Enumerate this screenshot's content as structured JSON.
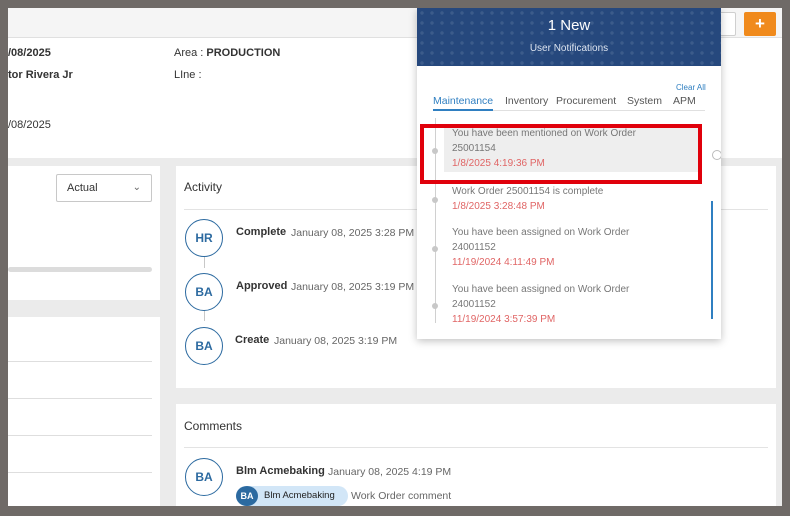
{
  "header": {
    "add_label": "+"
  },
  "info": {
    "date1": "/08/2025",
    "person": "tor Rivera Jr",
    "date2": "/08/2025",
    "area_label": "Area : ",
    "area_value": "PRODUCTION",
    "line_label": "LIne :"
  },
  "left_panel": {
    "select_value": "Actual"
  },
  "activity": {
    "title": "Activity",
    "items": [
      {
        "initials": "HR",
        "action": "Complete",
        "date": "January 08, 2025 3:28 PM"
      },
      {
        "initials": "BA",
        "action": "Approved",
        "date": "January 08, 2025 3:19 PM"
      },
      {
        "initials": "BA",
        "action": "Create",
        "date": "January 08, 2025 3:19 PM"
      }
    ]
  },
  "comments": {
    "title": "Comments",
    "items": [
      {
        "initials": "BA",
        "author": "Blm Acmebaking",
        "date": "January 08, 2025 4:19 PM",
        "mention_initials": "BA",
        "mention_name": "Blm Acmebaking",
        "text": "Work Order comment"
      }
    ]
  },
  "notifications": {
    "title": "1 New",
    "subtitle": "User Notifications",
    "clear_all": "Clear All",
    "tabs": [
      {
        "label": "Maintenance",
        "active": true
      },
      {
        "label": "Inventory",
        "active": false
      },
      {
        "label": "Procurement",
        "active": false
      },
      {
        "label": "System",
        "active": false
      },
      {
        "label": "APM",
        "active": false
      }
    ],
    "items": [
      {
        "line1": "You have been mentioned on Work Order",
        "line2": "25001154",
        "date": "1/8/2025 4:19:36 PM",
        "highlighted": true
      },
      {
        "line1": "Work Order 25001154 is complete",
        "line2": "",
        "date": "1/8/2025 3:28:48 PM",
        "highlighted": false
      },
      {
        "line1": "You have been assigned on Work Order",
        "line2": "24001152",
        "date": "11/19/2024 4:11:49 PM",
        "highlighted": false
      },
      {
        "line1": "You have been assigned on Work Order",
        "line2": "24001152",
        "date": "11/19/2024 3:57:39 PM",
        "highlighted": false
      }
    ]
  },
  "colors": {
    "accent": "#2f7fc1",
    "brand_header": "#26487d",
    "add_button": "#f08a1c",
    "date_red": "#e06565",
    "highlight_box": "#e0000b"
  },
  "icons": {
    "select_chevron": "chevron-down-icon",
    "notif_close": "close-circle-icon"
  }
}
